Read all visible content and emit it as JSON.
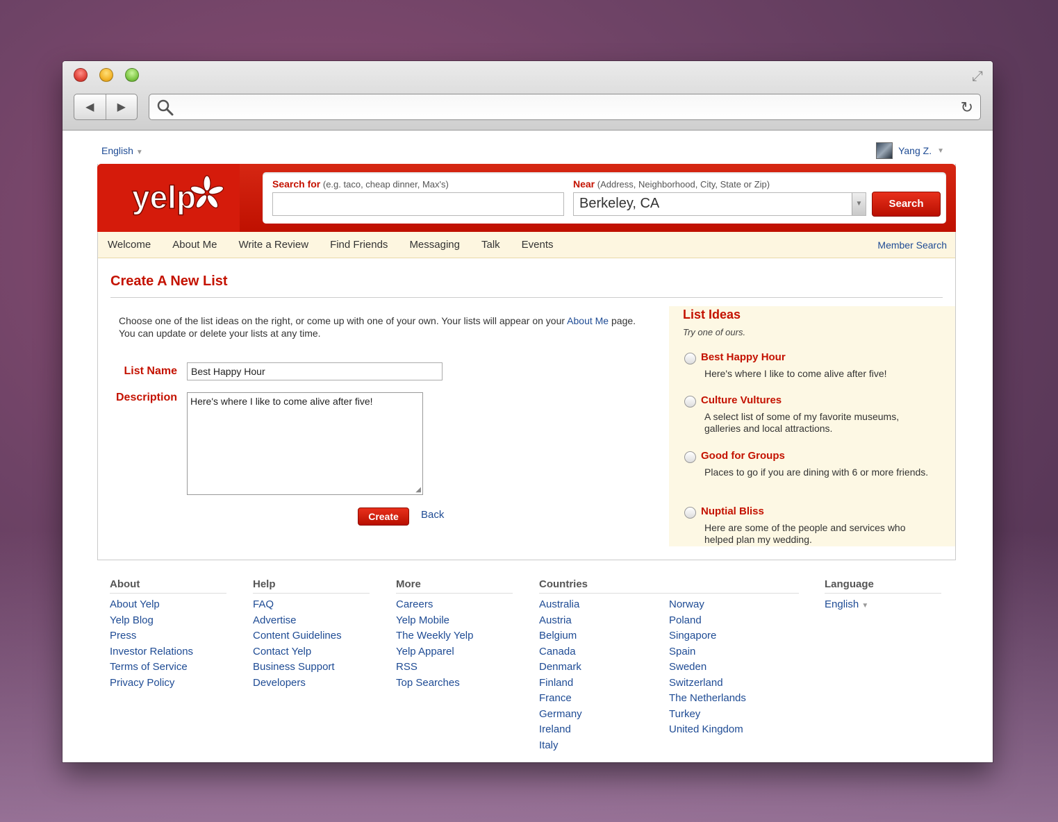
{
  "browser": {
    "back_icon": "triangle-left",
    "forward_icon": "triangle-right",
    "url": ""
  },
  "page": {
    "language_top": "English",
    "user_name": "Yang Z."
  },
  "header": {
    "logo_text": "yelp",
    "search_for_label": "Search for",
    "search_for_hint": "(e.g. taco, cheap dinner, Max's)",
    "search_for_value": "",
    "near_label": "Near",
    "near_hint_prefix": "(Address,",
    "near_hint_link": "Neighborhood",
    "near_hint_suffix": ", City, State or Zip)",
    "near_value": "Berkeley, CA",
    "search_button": "Search"
  },
  "tabs": {
    "items": [
      {
        "label": "Welcome"
      },
      {
        "label": "About Me"
      },
      {
        "label": "Write a Review"
      },
      {
        "label": "Find Friends"
      },
      {
        "label": "Messaging"
      },
      {
        "label": "Talk"
      },
      {
        "label": "Events"
      }
    ],
    "member_search": "Member Search"
  },
  "form": {
    "title": "Create A New List",
    "intro_text": "Choose one of the list ideas on the right, or come up with one of your own. Your lists will appear on your",
    "intro_link": "About Me",
    "intro_text_end": "page. You can update or delete your lists at any time.",
    "list_name_label": "List Name",
    "list_name_value": "Best Happy Hour",
    "description_label": "Description",
    "description_value": "Here's where I like to come alive after five!",
    "create_button": "Create",
    "back_link": "Back"
  },
  "ideas": {
    "title": "List Ideas",
    "subtitle": "Try one of ours.",
    "items": [
      {
        "title": "Best Happy Hour",
        "desc": "Here's where I like to come alive after five!"
      },
      {
        "title": "Culture Vultures",
        "desc": "A select list of some of my favorite museums, galleries and local attractions."
      },
      {
        "title": "Good for Groups",
        "desc": "Places to go if you are dining with 6 or more friends."
      },
      {
        "title": "Nuptial Bliss",
        "desc": "Here are some of the people and services who helped plan my wedding."
      }
    ]
  },
  "footer": {
    "about": {
      "heading": "About",
      "links": [
        "About Yelp",
        "Yelp Blog",
        "Press",
        "Investor Relations",
        "Terms of Service",
        "Privacy Policy"
      ]
    },
    "help": {
      "heading": "Help",
      "links": [
        "FAQ",
        "Advertise",
        "Content Guidelines",
        "Contact Yelp",
        "Business Support",
        "Developers"
      ]
    },
    "more": {
      "heading": "More",
      "links": [
        "Careers",
        "Yelp Mobile",
        "The Weekly Yelp",
        "Yelp Apparel",
        "RSS",
        "Top Searches"
      ]
    },
    "countries": {
      "heading": "Countries",
      "col1": [
        "Australia",
        "Austria",
        "Belgium",
        "Canada",
        "Denmark",
        "Finland",
        "France",
        "Germany",
        "Ireland",
        "Italy"
      ],
      "col2": [
        "Norway",
        "Poland",
        "Singapore",
        "Spain",
        "Sweden",
        "Switzerland",
        "The Netherlands",
        "Turkey",
        "United Kingdom"
      ]
    },
    "language": {
      "heading": "Language",
      "value": "English"
    }
  },
  "colors": {
    "brand_red": "#c41200",
    "link_blue": "#1e4b94",
    "tab_bg": "#fdf6e0",
    "ideas_bg": "#fdf8e4"
  }
}
